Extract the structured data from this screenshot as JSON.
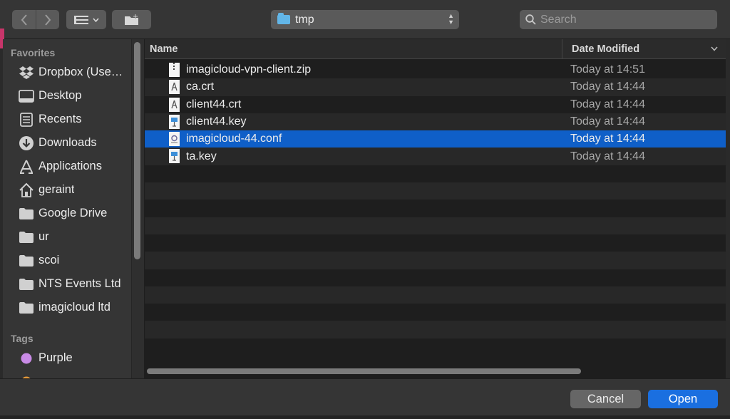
{
  "toolbar": {
    "back_icon": "chevron-left-icon",
    "forward_icon": "chevron-right-icon",
    "view_icon": "list-view-icon",
    "new_folder_icon": "new-folder-icon",
    "location": "tmp",
    "search_placeholder": "Search"
  },
  "sidebar": {
    "favorites_heading": "Favorites",
    "favorites": [
      {
        "label": "Dropbox (Use…",
        "icon": "dropbox-icon"
      },
      {
        "label": "Desktop",
        "icon": "desktop-icon"
      },
      {
        "label": "Recents",
        "icon": "recents-icon"
      },
      {
        "label": "Downloads",
        "icon": "downloads-icon"
      },
      {
        "label": "Applications",
        "icon": "applications-icon"
      },
      {
        "label": "geraint",
        "icon": "home-icon"
      },
      {
        "label": "Google Drive",
        "icon": "folder-icon"
      },
      {
        "label": "ur",
        "icon": "folder-icon"
      },
      {
        "label": "scoi",
        "icon": "folder-icon"
      },
      {
        "label": "NTS Events Ltd",
        "icon": "folder-icon"
      },
      {
        "label": "imagicloud ltd",
        "icon": "folder-icon"
      }
    ],
    "tags_heading": "Tags",
    "tags": [
      {
        "label": "Purple",
        "color": "#c98be6"
      }
    ]
  },
  "filelist": {
    "col_name": "Name",
    "col_date": "Date Modified",
    "files": [
      {
        "name": "imagicloud-vpn-client.zip",
        "date": "Today at 14:51",
        "icon": "zip-file-icon",
        "selected": false
      },
      {
        "name": "ca.crt",
        "date": "Today at 14:44",
        "icon": "certificate-file-icon",
        "selected": false
      },
      {
        "name": "client44.crt",
        "date": "Today at 14:44",
        "icon": "certificate-file-icon",
        "selected": false
      },
      {
        "name": "client44.key",
        "date": "Today at 14:44",
        "icon": "keynote-file-icon",
        "selected": false
      },
      {
        "name": "imagicloud-44.conf",
        "date": "Today at 14:44",
        "icon": "conf-file-icon",
        "selected": true
      },
      {
        "name": "ta.key",
        "date": "Today at 14:44",
        "icon": "keynote-file-icon",
        "selected": false
      }
    ]
  },
  "buttons": {
    "cancel": "Cancel",
    "open": "Open"
  }
}
